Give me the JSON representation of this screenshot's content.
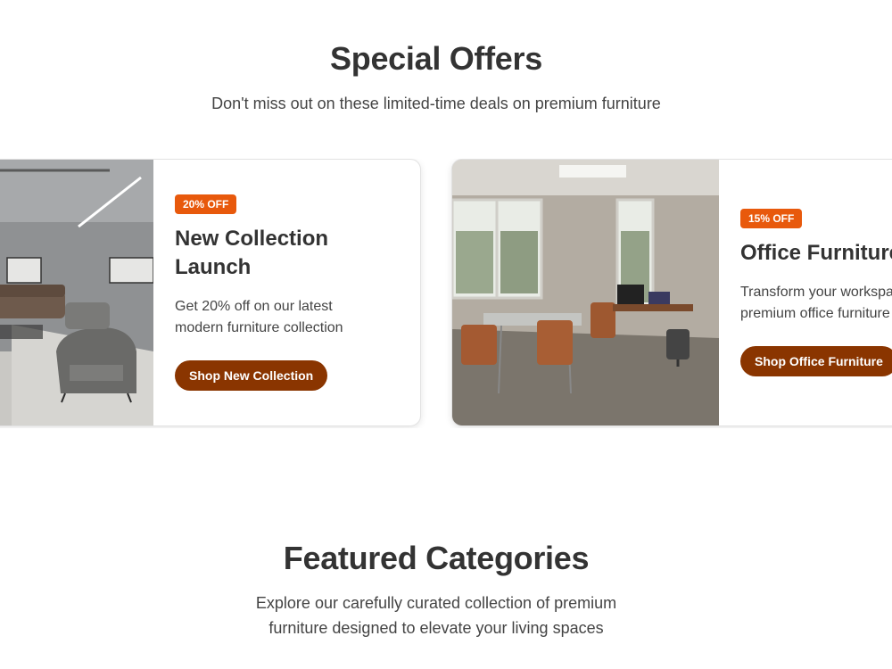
{
  "special_offers": {
    "title": "Special Offers",
    "subtitle": "Don't miss out on these limited-time deals on premium furniture",
    "cards": [
      {
        "badge": "20% OFF",
        "title": "New Collection Launch",
        "description": "Get 20% off on our latest modern furniture collection",
        "button": "Shop New Collection",
        "image": "living-room-photo"
      },
      {
        "badge": "15% OFF",
        "title": "Office Furniture",
        "description": "Transform your workspace with premium office furniture",
        "button": "Shop Office Furniture",
        "image": "office-room-photo"
      }
    ]
  },
  "featured_categories": {
    "title": "Featured Categories",
    "subtitle": "Explore our carefully curated collection of premium furniture designed to elevate your living spaces"
  },
  "colors": {
    "badge": "#e8590c",
    "button": "#8a3500",
    "heading": "#333333"
  }
}
